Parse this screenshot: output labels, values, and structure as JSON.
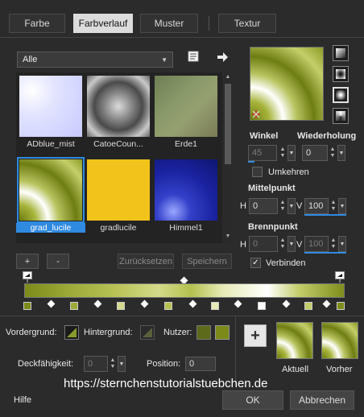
{
  "tabs": [
    "Farbe",
    "Farbverlauf",
    "Muster",
    "Textur"
  ],
  "category": {
    "selected": "Alle"
  },
  "thumbnails": [
    {
      "label": "ADblue_mist"
    },
    {
      "label": "CatoeCoun..."
    },
    {
      "label": "Erde1"
    },
    {
      "label": "grad_lucile"
    },
    {
      "label": "gradlucile"
    },
    {
      "label": "Himmel1"
    }
  ],
  "buttons": {
    "add": "+",
    "remove": "-",
    "reset": "Zurücksetzen",
    "save": "Speichern",
    "ok": "OK",
    "cancel": "Abbrechen",
    "help": "Hilfe",
    "big_add": "+"
  },
  "angle": {
    "label": "Winkel",
    "value": "45"
  },
  "repeat": {
    "label": "Wiederholung",
    "value": "0"
  },
  "invert": {
    "label": "Umkehren",
    "checked": false
  },
  "center": {
    "label": "Mittelpunkt",
    "h_label": "H",
    "h_value": "0",
    "v_label": "V",
    "v_value": "100"
  },
  "focus": {
    "label": "Brennpunkt",
    "h_label": "H",
    "h_value": "0",
    "v_label": "V",
    "v_value": "100"
  },
  "link": {
    "label": "Verbinden",
    "checked": true
  },
  "stops": {
    "foreground": "Vordergrund:",
    "background": "Hintergrund:",
    "user": "Nutzer:",
    "opacity_label": "Deckfähigkeit:",
    "opacity_value": "0",
    "position_label": "Position:",
    "position_value": "0"
  },
  "preview": {
    "current": "Aktuell",
    "previous": "Vorher"
  },
  "watermark": "https://sternchenstutorialstuebchen.de",
  "colors": {
    "accent": "#2f8ae0",
    "olive": "#8a9a2a"
  }
}
